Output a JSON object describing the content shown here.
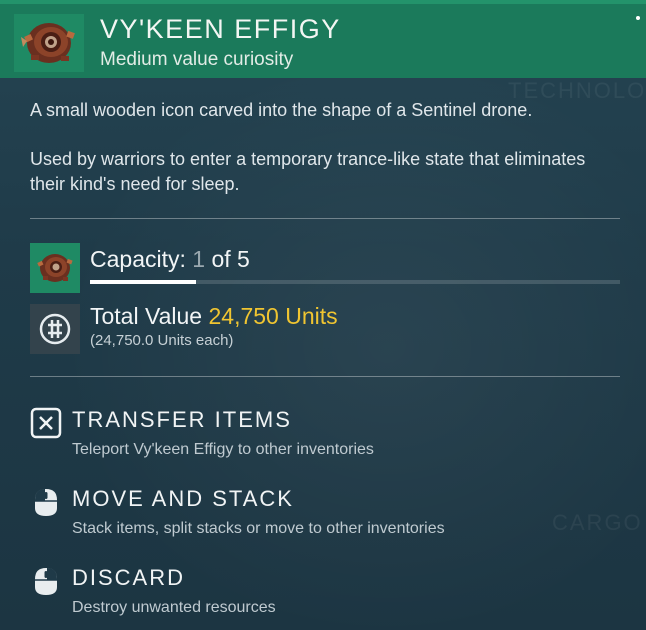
{
  "item": {
    "name": "VY'KEEN EFFIGY",
    "subtitle": "Medium value curiosity",
    "description_1": "A small wooden icon carved into the shape of a Sentinel drone.",
    "description_2": "Used by warriors to enter a temporary trance-like state that eliminates their kind's need for sleep."
  },
  "capacity": {
    "label": "Capacity:",
    "current": "1",
    "of_text": "of 5",
    "fraction": 0.2
  },
  "value": {
    "label": "Total Value",
    "amount": "24,750 Units",
    "each": "(24,750.0 Units each)"
  },
  "actions": [
    {
      "key": "X",
      "label": "TRANSFER ITEMS",
      "hint": "Teleport Vy'keen Effigy to other inventories",
      "icon": "x-key-icon"
    },
    {
      "key": "mouse",
      "label": "MOVE AND STACK",
      "hint": "Stack items, split stacks or move to other inventories",
      "icon": "mouse-left-icon"
    },
    {
      "key": "mouse",
      "label": "DISCARD",
      "hint": "Destroy unwanted resources",
      "icon": "mouse-right-icon"
    }
  ],
  "background_text": [
    "TECHNOLO",
    "CARGO"
  ],
  "colors": {
    "header": "#1b7a5b",
    "panel": "#1f3a48",
    "value_highlight": "#f0c531",
    "capacity_current": "#9aa8af"
  }
}
